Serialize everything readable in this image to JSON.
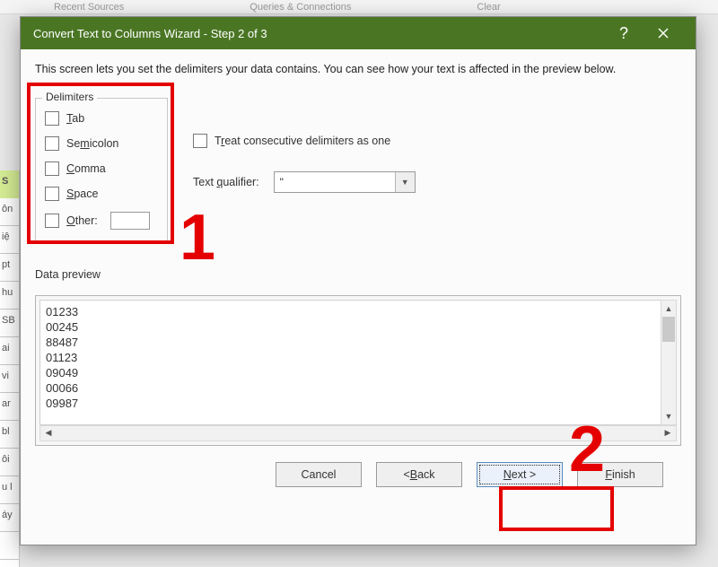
{
  "bg": {
    "ribbon_left": "Recent Sources",
    "ribbon_mid": "Queries & Connections",
    "ribbon_right": "Clear",
    "cells": [
      "S",
      "ôn",
      "iệ",
      "pt",
      "hu",
      "SB",
      "ai",
      "vi",
      "ar",
      "bl",
      "ôi",
      "u l",
      "áy"
    ]
  },
  "title": "Convert Text to Columns Wizard - Step 2 of 3",
  "description": "This screen lets you set the delimiters your data contains.  You can see how your text is affected in the preview below.",
  "delimiters": {
    "legend": "Delimiters",
    "tab": {
      "pre": "",
      "mn": "T",
      "post": "ab"
    },
    "semi": {
      "pre": "Se",
      "mn": "m",
      "post": "icolon"
    },
    "comma": {
      "pre": "",
      "mn": "C",
      "post": "omma"
    },
    "space": {
      "pre": "",
      "mn": "S",
      "post": "pace"
    },
    "other": {
      "pre": "",
      "mn": "O",
      "post": "ther:"
    }
  },
  "consecutive": {
    "pre": "T",
    "mn": "r",
    "post": "eat consecutive delimiters as one"
  },
  "qualifier": {
    "label_pre": "Text ",
    "label_mn": "q",
    "label_post": "ualifier:",
    "value": "\""
  },
  "preview_label": "Data preview",
  "preview_rows": [
    "01233",
    "00245",
    "88487",
    "01123",
    "09049",
    "00066",
    "09987"
  ],
  "buttons": {
    "cancel": "Cancel",
    "back": {
      "pre": "< ",
      "mn": "B",
      "post": "ack"
    },
    "next": {
      "pre": "",
      "mn": "N",
      "post": "ext >"
    },
    "finish": {
      "pre": "",
      "mn": "F",
      "post": "inish"
    }
  },
  "annotations": {
    "num1": "1",
    "num2": "2"
  }
}
